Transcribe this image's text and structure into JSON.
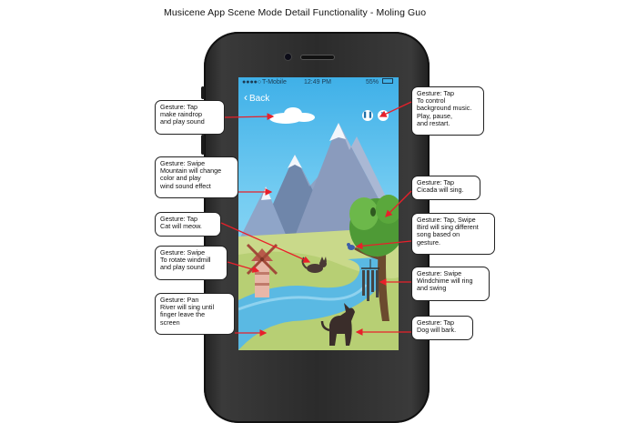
{
  "title": "Musicene App Scene Mode Detail Functionality - Moling Guo",
  "status_bar": {
    "carrier": "T-Mobile",
    "time": "12:49 PM",
    "battery": "55%"
  },
  "back_label": "Back",
  "callouts": {
    "raindrop": {
      "lines": [
        "Gesture: Tap",
        "make raindrop",
        "and play sound"
      ]
    },
    "mountain": {
      "lines": [
        "Gesture: Swipe",
        "Mountain will change",
        "color and play",
        "wind sound effect"
      ]
    },
    "cat": {
      "lines": [
        "Gesture: Tap",
        "Cat will meow."
      ]
    },
    "windmill": {
      "lines": [
        "Gesture: Swipe",
        "To rotate windmill",
        "and play sound"
      ]
    },
    "river": {
      "lines": [
        "Gesture: Pan",
        "River will sing until",
        "finger leave the",
        "screen"
      ]
    },
    "music": {
      "lines": [
        "Gesture: Tap",
        "To control",
        "background music.",
        "Play, pause,",
        "and restart."
      ]
    },
    "cicada": {
      "lines": [
        "Gesture: Tap",
        "Cicada will sing."
      ]
    },
    "bird": {
      "lines": [
        "Gesture: Tap, Swipe",
        "Bird will sing different",
        "song based on",
        "gesture."
      ]
    },
    "windchime": {
      "lines": [
        "Gesture: Swipe",
        "Windchime will ring",
        "and swing"
      ]
    },
    "dog": {
      "lines": [
        "Gesture: Tap",
        "Dog will bark."
      ]
    }
  },
  "colors": {
    "arrow": "#e8202a",
    "sky_top": "#3fb0e8",
    "grass": "#c9d98a",
    "river": "#5ab9e3",
    "mountain": "#8a9bbd"
  }
}
